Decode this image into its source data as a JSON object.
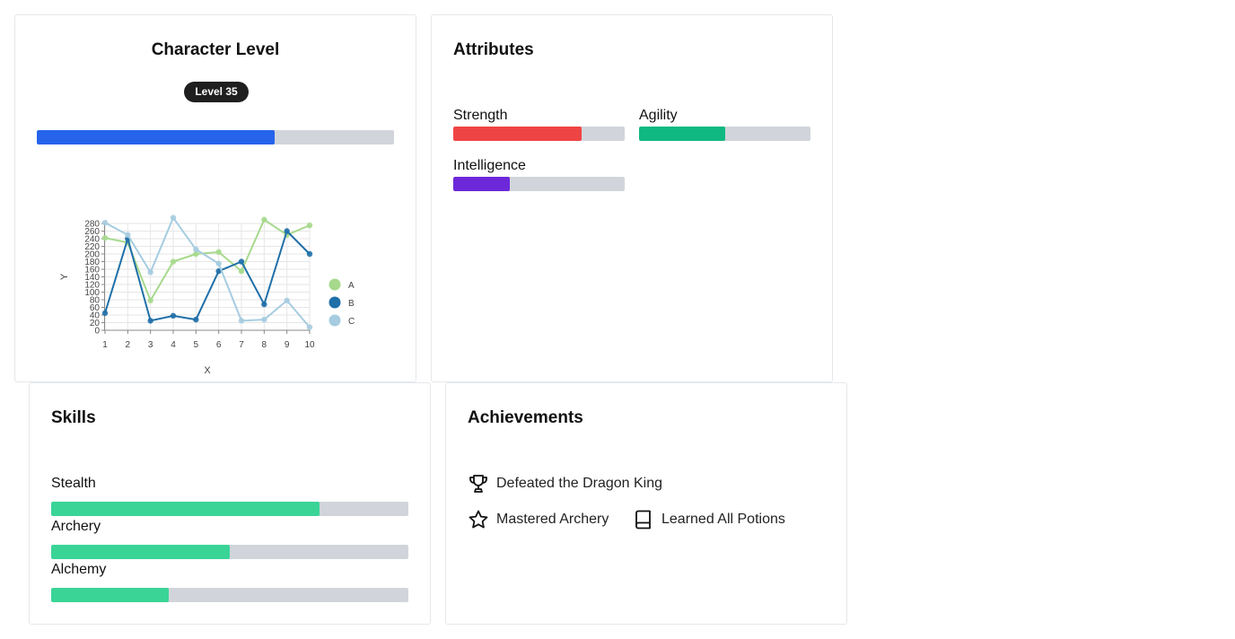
{
  "level_card": {
    "title": "Character Level",
    "badge": "Level 35",
    "progress": 0.665,
    "bar_color": "#2563eb"
  },
  "chart_data": {
    "type": "line",
    "x": [
      1,
      2,
      3,
      4,
      5,
      6,
      7,
      8,
      9,
      10
    ],
    "xlabel": "X",
    "ylabel": "Y",
    "ylim": [
      0,
      280
    ],
    "yticks": [
      0,
      20,
      40,
      60,
      80,
      100,
      120,
      140,
      160,
      180,
      200,
      220,
      240,
      260,
      280
    ],
    "grid": true,
    "legend": "right",
    "series": [
      {
        "name": "A",
        "color": "#a6d98c",
        "values": [
          242,
          230,
          78,
          180,
          200,
          205,
          155,
          290,
          250,
          275
        ]
      },
      {
        "name": "B",
        "color": "#1f6fa8",
        "values": [
          45,
          240,
          25,
          38,
          28,
          155,
          180,
          68,
          260,
          200
        ]
      },
      {
        "name": "C",
        "color": "#a6cce0",
        "values": [
          282,
          250,
          152,
          295,
          212,
          175,
          25,
          28,
          78,
          8
        ]
      }
    ]
  },
  "attributes": {
    "title": "Attributes",
    "items": [
      {
        "label": "Strength",
        "value": 0.75,
        "color": "#ef4444"
      },
      {
        "label": "Agility",
        "value": 0.5,
        "color": "#10b981"
      },
      {
        "label": "Intelligence",
        "value": 0.33,
        "color": "#6d28d9"
      }
    ]
  },
  "skills": {
    "title": "Skills",
    "items": [
      {
        "label": "Stealth",
        "value": 0.75,
        "color": "#3ad497"
      },
      {
        "label": "Archery",
        "value": 0.5,
        "color": "#3ad497"
      },
      {
        "label": "Alchemy",
        "value": 0.33,
        "color": "#3ad497"
      }
    ]
  },
  "achievements": {
    "title": "Achievements",
    "items": [
      {
        "label": "Defeated the Dragon King",
        "icon": "trophy-icon"
      },
      {
        "label": "Mastered Archery",
        "icon": "star-icon"
      },
      {
        "label": "Learned All Potions",
        "icon": "book-icon"
      }
    ]
  }
}
